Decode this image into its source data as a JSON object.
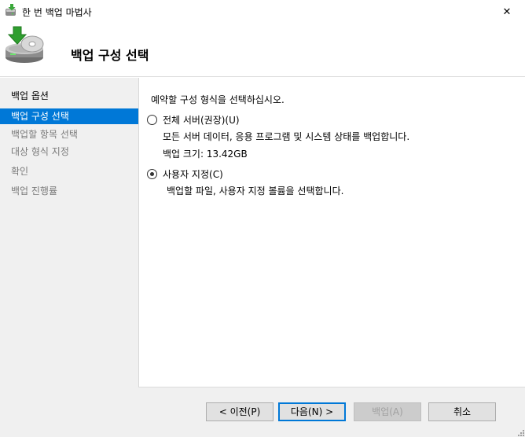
{
  "window": {
    "title": "한 번 백업 마법사",
    "close_glyph": "✕"
  },
  "header": {
    "page_title": "백업 구성 선택"
  },
  "sidebar": {
    "items": [
      {
        "label": "백업 옵션",
        "state": "done"
      },
      {
        "label": "백업 구성 선택",
        "state": "active"
      },
      {
        "label": "백업할 항목 선택",
        "state": "pending"
      },
      {
        "label": "대상 형식 지정",
        "state": "pending"
      },
      {
        "label": "확인",
        "state": "pending"
      },
      {
        "label": "백업 진행률",
        "state": "pending"
      }
    ]
  },
  "main": {
    "prompt": "예약할 구성 형식을 선택하십시오.",
    "options": [
      {
        "label": "전체 서버(권장)(U)",
        "checked": false,
        "description": "모든 서버 데이터, 응용 프로그램 및 시스템 상태를 백업합니다.",
        "size_label": "백업 크기: 13.42GB"
      },
      {
        "label": "사용자 지정(C)",
        "checked": true,
        "description": "백업할 파일, 사용자 지정 볼륨을 선택합니다."
      }
    ]
  },
  "footer": {
    "prev_label": "< 이전(P)",
    "next_label": "다음(N) >",
    "backup_label": "백업(A)",
    "cancel_label": "취소"
  },
  "colors": {
    "accent": "#0078d7",
    "sidebar_bg": "#f0f0f0",
    "disabled_text": "#a0a0a0"
  }
}
